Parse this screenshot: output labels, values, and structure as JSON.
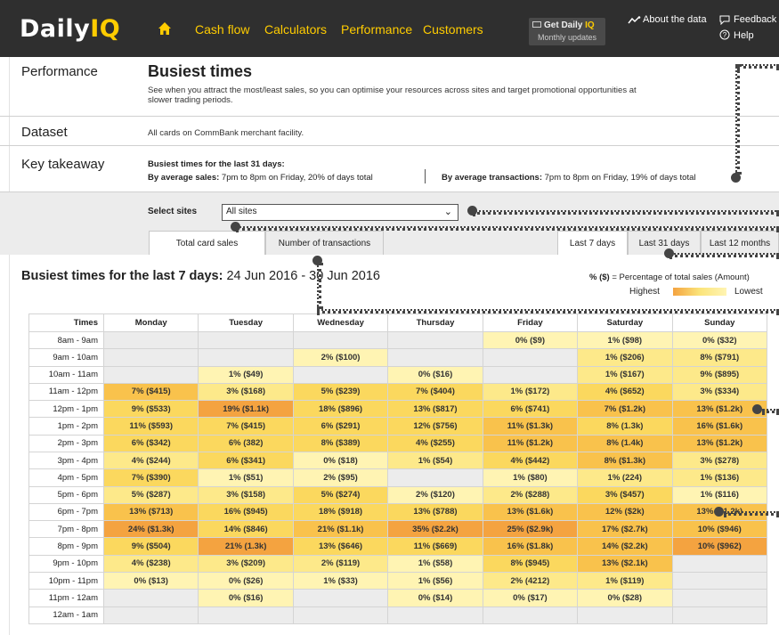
{
  "header": {
    "logo_main": "Daily",
    "logo_accent": "IQ",
    "nav": [
      "Cash flow",
      "Calculators",
      "Performance",
      "Customers"
    ],
    "promo_line1_main": "Get Daily ",
    "promo_line1_accent": "IQ",
    "promo_line2": "Monthly updates",
    "about_data": "About the data",
    "feedback": "Feedback",
    "help": "Help"
  },
  "sections": {
    "performance_label": "Performance",
    "title": "Busiest times",
    "description": "See when you attract the most/least sales, so you can optimise your resources across sites and target promotional opportunities at slower trading periods.",
    "dataset_label": "Dataset",
    "dataset_value": "All cards on CommBank merchant facility.",
    "takeaway_label": "Key takeaway",
    "takeaway_heading": "Busiest times for the last 31 days:",
    "by_sales_label": "By average sales:",
    "by_sales_value": "7pm to 8pm on Friday, 20% of days total",
    "by_txn_label": "By average transactions:",
    "by_txn_value": "7pm to 8pm on Friday, 19% of days total"
  },
  "controls": {
    "select_label": "Select sites",
    "select_value": "All sites",
    "tab_sales": "Total card sales",
    "tab_txn": "Number of transactions",
    "period_7": "Last 7 days",
    "period_31": "Last 31 days",
    "period_12m": "Last 12 months"
  },
  "chart": {
    "title_bold": "Busiest times for the last 7 days:",
    "title_range": "24 Jun 2016 - 30 Jun 2016",
    "legend_title_bold": "% ($)",
    "legend_title_rest": "= Percentage of total sales (Amount)",
    "legend_high": "Highest",
    "legend_low": "Lowest"
  },
  "colors": {
    "accent": "#ffcc00",
    "topbar": "#2f2f2f",
    "empty": "#ececec",
    "level1": "#fff4b3",
    "level2": "#fde98a",
    "level3": "#fbd85e",
    "level4": "#f9c24c",
    "level5": "#f4a340"
  },
  "table": {
    "times_header": "Times",
    "days": [
      "Monday",
      "Tuesday",
      "Wednesday",
      "Thursday",
      "Friday",
      "Saturday",
      "Sunday"
    ],
    "rows": [
      {
        "time": "8am - 9am",
        "cells": [
          [
            "",
            0
          ],
          [
            "",
            0
          ],
          [
            "",
            0
          ],
          [
            "",
            0
          ],
          [
            "0% ($9)",
            1
          ],
          [
            "1% ($98)",
            1
          ],
          [
            "0% ($32)",
            1
          ]
        ]
      },
      {
        "time": "9am - 10am",
        "cells": [
          [
            "",
            0
          ],
          [
            "",
            0
          ],
          [
            "2% ($100)",
            1
          ],
          [
            "",
            0
          ],
          [
            "",
            0
          ],
          [
            "1% ($206)",
            2
          ],
          [
            "8% ($791)",
            2
          ]
        ]
      },
      {
        "time": "10am - 11am",
        "cells": [
          [
            "",
            0
          ],
          [
            "1% ($49)",
            1
          ],
          [
            "",
            0
          ],
          [
            "0% ($16)",
            1
          ],
          [
            "",
            0
          ],
          [
            "1% ($167)",
            2
          ],
          [
            "9% ($895)",
            2
          ]
        ]
      },
      {
        "time": "11am - 12pm",
        "cells": [
          [
            "7% ($415)",
            4
          ],
          [
            "3% ($168)",
            2
          ],
          [
            "5% ($239)",
            3
          ],
          [
            "7% ($404)",
            3
          ],
          [
            "1% ($172)",
            2
          ],
          [
            "4% ($652)",
            3
          ],
          [
            "3% ($334)",
            2
          ]
        ]
      },
      {
        "time": "12pm - 1pm",
        "cells": [
          [
            "9% ($533)",
            3
          ],
          [
            "19% ($1.1k)",
            5
          ],
          [
            "18% ($896)",
            3
          ],
          [
            "13% ($817)",
            3
          ],
          [
            "6% ($741)",
            3
          ],
          [
            "7% ($1.2k)",
            4
          ],
          [
            "13% ($1.2k)",
            4
          ]
        ]
      },
      {
        "time": "1pm - 2pm",
        "cells": [
          [
            "11% ($593)",
            3
          ],
          [
            "7% ($415)",
            3
          ],
          [
            "6% ($291)",
            3
          ],
          [
            "12% ($756)",
            3
          ],
          [
            "11% ($1.3k)",
            4
          ],
          [
            "8% (1.3k)",
            3
          ],
          [
            "16% ($1.6k)",
            4
          ]
        ]
      },
      {
        "time": "2pm - 3pm",
        "cells": [
          [
            "6% ($342)",
            3
          ],
          [
            "6% (382)",
            3
          ],
          [
            "8% ($389)",
            3
          ],
          [
            "4% ($255)",
            3
          ],
          [
            "11% ($1.2k)",
            4
          ],
          [
            "8% (1.4k)",
            4
          ],
          [
            "13% ($1.2k)",
            4
          ]
        ]
      },
      {
        "time": "3pm - 4pm",
        "cells": [
          [
            "4% ($244)",
            2
          ],
          [
            "6% ($341)",
            3
          ],
          [
            "0% ($18)",
            1
          ],
          [
            "1% ($54)",
            2
          ],
          [
            "4% ($442)",
            3
          ],
          [
            "8% ($1.3k)",
            4
          ],
          [
            "3% ($278)",
            2
          ]
        ]
      },
      {
        "time": "4pm - 5pm",
        "cells": [
          [
            "7% ($390)",
            3
          ],
          [
            "1% ($51)",
            1
          ],
          [
            "2% ($95)",
            1
          ],
          [
            "",
            0
          ],
          [
            "1% ($80)",
            1
          ],
          [
            "1% (224)",
            2
          ],
          [
            "1% ($136)",
            2
          ]
        ]
      },
      {
        "time": "5pm - 6pm",
        "cells": [
          [
            "5% ($287)",
            2
          ],
          [
            "3% ($158)",
            2
          ],
          [
            "5% ($274)",
            3
          ],
          [
            "2% ($120)",
            1
          ],
          [
            "2% ($288)",
            2
          ],
          [
            "3% ($457)",
            3
          ],
          [
            "1% ($116)",
            1
          ]
        ]
      },
      {
        "time": "6pm - 7pm",
        "cells": [
          [
            "13% ($713)",
            4
          ],
          [
            "16% ($945)",
            3
          ],
          [
            "18% ($918)",
            3
          ],
          [
            "13% ($788)",
            3
          ],
          [
            "13% ($1.6k)",
            4
          ],
          [
            "12% ($2k)",
            4
          ],
          [
            "13% ($1.2k)",
            4
          ]
        ]
      },
      {
        "time": "7pm - 8pm",
        "cells": [
          [
            "24% ($1.3k)",
            5
          ],
          [
            "14% ($846)",
            3
          ],
          [
            "21% ($1.1k)",
            4
          ],
          [
            "35% ($2.2k)",
            5
          ],
          [
            "25% ($2.9k)",
            5
          ],
          [
            "17% ($2.7k)",
            4
          ],
          [
            "10% ($946)",
            4
          ]
        ]
      },
      {
        "time": "8pm - 9pm",
        "cells": [
          [
            "9% ($504)",
            3
          ],
          [
            "21% (1.3k)",
            5
          ],
          [
            "13% ($646)",
            3
          ],
          [
            "11% ($669)",
            3
          ],
          [
            "16% ($1.8k)",
            4
          ],
          [
            "14% ($2.2k)",
            4
          ],
          [
            "10% ($962)",
            5
          ]
        ]
      },
      {
        "time": "9pm - 10pm",
        "cells": [
          [
            "4% ($238)",
            2
          ],
          [
            "3% ($209)",
            2
          ],
          [
            "2% ($119)",
            2
          ],
          [
            "1% ($58)",
            1
          ],
          [
            "8% ($945)",
            3
          ],
          [
            "13% ($2.1k)",
            4
          ],
          [
            "",
            0
          ]
        ]
      },
      {
        "time": "10pm - 11pm",
        "cells": [
          [
            "0% ($13)",
            1
          ],
          [
            "0% ($26)",
            1
          ],
          [
            "1% ($33)",
            1
          ],
          [
            "1% ($56)",
            1
          ],
          [
            "2% (4212)",
            2
          ],
          [
            "1% ($119)",
            2
          ],
          [
            "",
            0
          ]
        ]
      },
      {
        "time": "11pm - 12am",
        "cells": [
          [
            "",
            0
          ],
          [
            "0% ($16)",
            1
          ],
          [
            "",
            0
          ],
          [
            "0% ($14)",
            1
          ],
          [
            "0% ($17)",
            1
          ],
          [
            "0% ($28)",
            1
          ],
          [
            "",
            0
          ]
        ]
      },
      {
        "time": "12am - 1am",
        "cells": [
          [
            "",
            0
          ],
          [
            "",
            0
          ],
          [
            "",
            0
          ],
          [
            "",
            0
          ],
          [
            "",
            0
          ],
          [
            "",
            0
          ],
          [
            "",
            0
          ]
        ]
      }
    ]
  }
}
